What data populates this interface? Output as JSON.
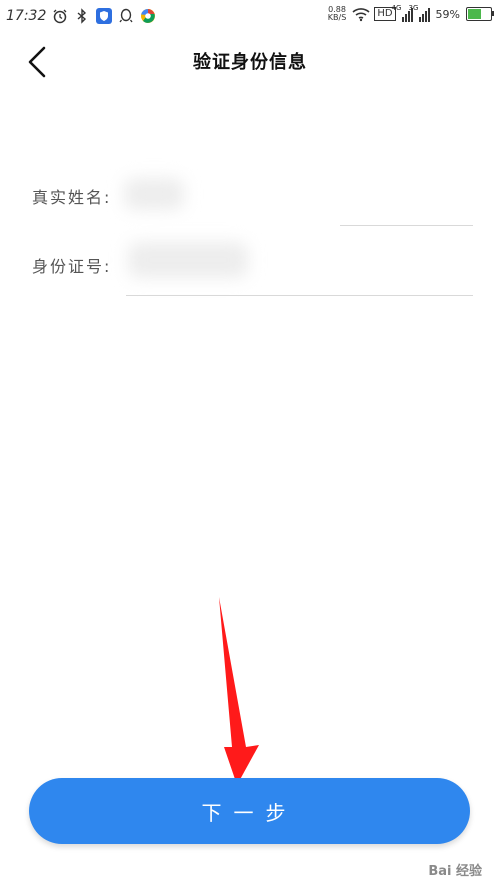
{
  "status_bar": {
    "time": "17:32",
    "net_speed_value": "0.88",
    "net_speed_unit": "KB/S",
    "hd": "HD",
    "signal1_tag": "4G",
    "signal2_tag": "3G",
    "battery_percent": "59%",
    "battery_level": 0.59
  },
  "header": {
    "title": "验证身份信息"
  },
  "form": {
    "name_label": "真实姓名:",
    "id_label": "身份证号:"
  },
  "footer": {
    "next_label": "下一步"
  },
  "watermark": "Bai 经验",
  "colors": {
    "button": "#2f87ee",
    "arrow": "#ff1a1a",
    "battery": "#4cb84c"
  }
}
